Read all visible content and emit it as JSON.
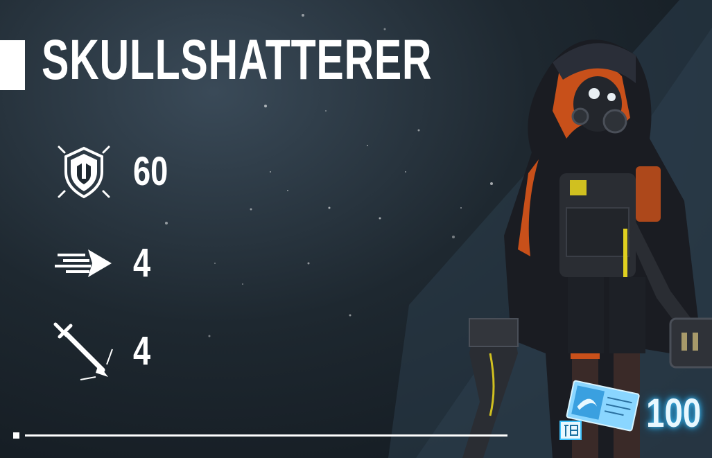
{
  "header": {
    "title": "SKULLSHATTERER"
  },
  "stats": {
    "armor": {
      "icon": "shield-icon",
      "value": "60"
    },
    "speed": {
      "icon": "speed-arrow-icon",
      "value": "4"
    },
    "attack": {
      "icon": "sword-icon",
      "value": "4"
    }
  },
  "cost": {
    "icon": "ticket-icon",
    "value": "100"
  },
  "colors": {
    "accent": "#e85a1a",
    "ticket_glow": "#3fc4ff",
    "background": "#1e2830"
  }
}
